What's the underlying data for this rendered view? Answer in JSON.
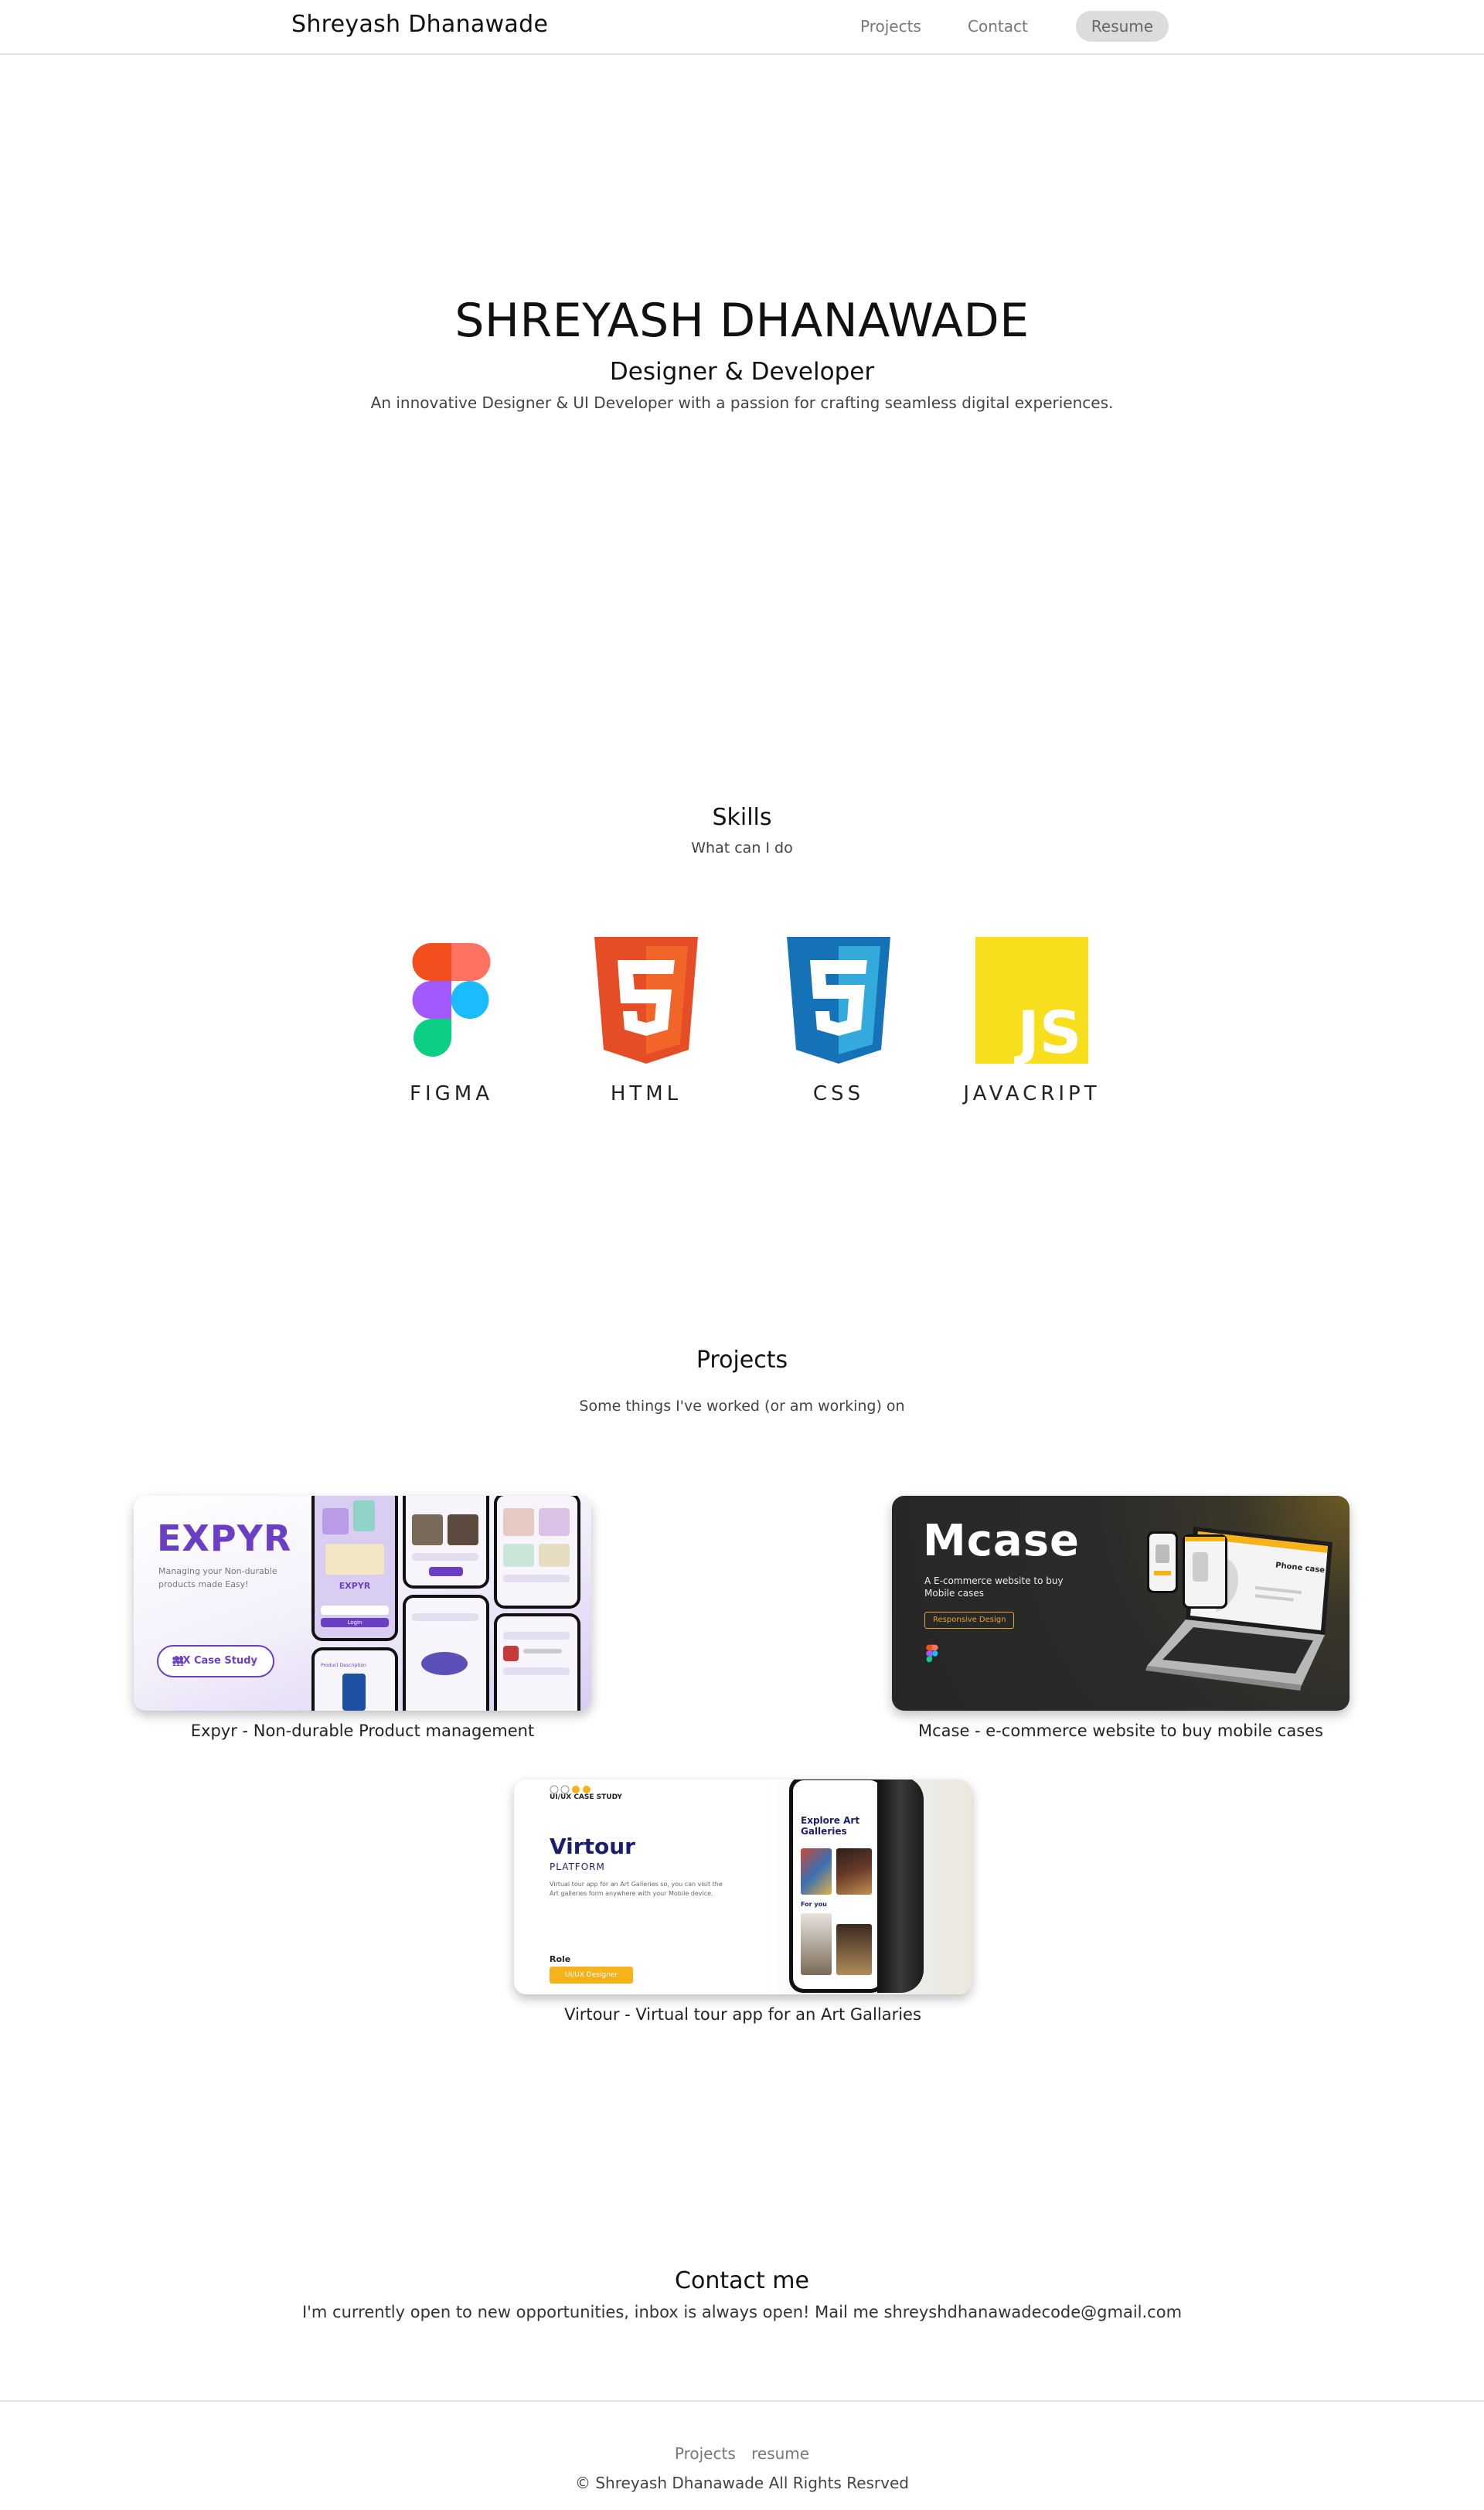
{
  "nav": {
    "brand": "Shreyash Dhanawade",
    "links": [
      "Projects",
      "Contact"
    ],
    "resume": "Resume"
  },
  "hero": {
    "name": "SHREYASH DHANAWADE",
    "role": "Designer & Developer",
    "description": "An innovative Designer & UI Developer with a passion for crafting seamless digital experiences."
  },
  "skills": {
    "title": "Skills",
    "subtitle": "What can I do",
    "items": [
      {
        "label": "FIGMA",
        "icon": "figma-icon"
      },
      {
        "label": "HTML",
        "icon": "html5-icon"
      },
      {
        "label": "CSS",
        "icon": "css3-icon"
      },
      {
        "label": "JAVACRIPT",
        "icon": "javascript-icon"
      }
    ]
  },
  "projects": {
    "title": "Projects",
    "subtitle": "Some things I've worked (or am working) on",
    "items": [
      {
        "caption": "Expyr - Non-durable Product management",
        "thumb_title": "EXPYR",
        "thumb_tagline": "Managing your Non-durable products made Easy!",
        "thumb_button": "UX Case Study",
        "thumb_phone_brand": "EXPYR",
        "thumb_phone_login": "Login",
        "thumb_phone_section": "Product Description"
      },
      {
        "caption": "Mcase - e-commerce website to buy mobile cases",
        "thumb_title": "Mcase",
        "thumb_subtitle": "A E-commerce website to buy Mobile cases",
        "thumb_chip": "Responsive Design",
        "thumb_screen_heading": "Phone case"
      },
      {
        "caption": "Virtour - Virtual tour app for an Art Gallaries",
        "thumb_kicker": "UI/UX CASE STUDY",
        "thumb_title": "Virtour",
        "thumb_platform": "PLATFORM",
        "thumb_desc": "Virtual tour app for an Art Galleries so, you can visit the Art galleries form anywhere with your Mobile device.",
        "thumb_role_label": "Role",
        "thumb_role": "UI/UX Designer",
        "thumb_phone_heading": "Explore Art Galleries",
        "thumb_phone_sub": "For you"
      }
    ]
  },
  "contact": {
    "title": "Contact me",
    "text": "I'm currently open to new opportunities, inbox is always open! Mail me shreyshdhanawadecode@gmail.com"
  },
  "footer": {
    "links": [
      "Projects",
      "resume"
    ],
    "copyright": "© Shreyash Dhanawade All Rights Resrved"
  },
  "colors": {
    "expyr_purple": "#6a3fc6",
    "html_orange": "#e44d26",
    "css_blue": "#1572b6",
    "js_yellow": "#f7df1e",
    "virtour_navy": "#1b1f6b",
    "accent_gold": "#f6b21a"
  }
}
